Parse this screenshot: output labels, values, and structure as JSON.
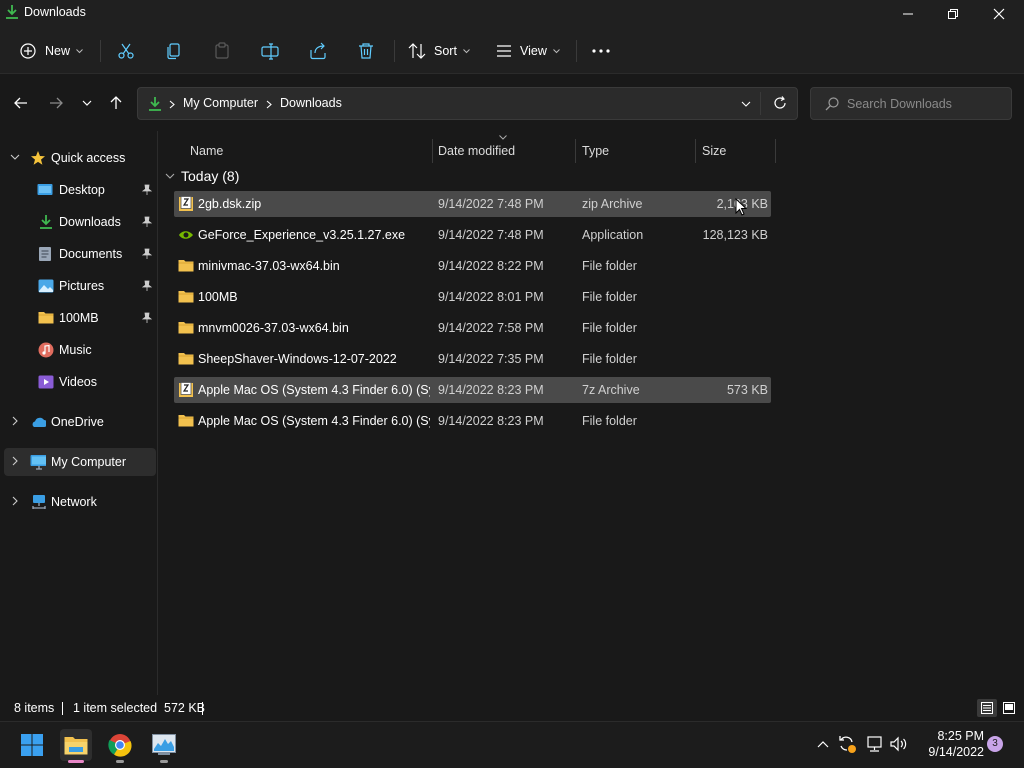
{
  "window": {
    "title": "Downloads"
  },
  "toolbar": {
    "new_label": "New",
    "sort_label": "Sort",
    "view_label": "View"
  },
  "address": {
    "crumbs": [
      "My Computer",
      "Downloads"
    ]
  },
  "search": {
    "placeholder": "Search Downloads"
  },
  "sidebar": {
    "items": [
      {
        "label": "Quick access",
        "icon": "star-icon"
      },
      {
        "label": "Desktop",
        "icon": "desktop-icon",
        "pinned": true
      },
      {
        "label": "Downloads",
        "icon": "download-icon",
        "pinned": true
      },
      {
        "label": "Documents",
        "icon": "documents-icon",
        "pinned": true
      },
      {
        "label": "Pictures",
        "icon": "pictures-icon",
        "pinned": true
      },
      {
        "label": "100MB",
        "icon": "folder-icon",
        "pinned": true
      },
      {
        "label": "Music",
        "icon": "music-icon"
      },
      {
        "label": "Videos",
        "icon": "videos-icon"
      },
      {
        "label": "OneDrive",
        "icon": "cloud-icon"
      },
      {
        "label": "My Computer",
        "icon": "computer-icon",
        "selected": true
      },
      {
        "label": "Network",
        "icon": "network-icon"
      }
    ]
  },
  "columns": {
    "name": "Name",
    "date": "Date modified",
    "type": "Type",
    "size": "Size"
  },
  "group": {
    "label": "Today (8)"
  },
  "files": [
    {
      "name": "2gb.dsk.zip",
      "date": "9/14/2022 7:48 PM",
      "type": "zip Archive",
      "size": "2,103 KB",
      "icon": "archive-icon",
      "selected": true
    },
    {
      "name": "GeForce_Experience_v3.25.1.27.exe",
      "date": "9/14/2022 7:48 PM",
      "type": "Application",
      "size": "128,123 KB",
      "icon": "nvidia-icon"
    },
    {
      "name": "minivmac-37.03-wx64.bin",
      "date": "9/14/2022 8:22 PM",
      "type": "File folder",
      "size": "",
      "icon": "folder-icon"
    },
    {
      "name": "100MB",
      "date": "9/14/2022 8:01 PM",
      "type": "File folder",
      "size": "",
      "icon": "folder-icon"
    },
    {
      "name": "mnvm0026-37.03-wx64.bin",
      "date": "9/14/2022 7:58 PM",
      "type": "File folder",
      "size": "",
      "icon": "folder-icon"
    },
    {
      "name": "SheepShaver-Windows-12-07-2022",
      "date": "9/14/2022 7:35 PM",
      "type": "File folder",
      "size": "",
      "icon": "folder-icon"
    },
    {
      "name": "Apple Mac OS (System 4.3 Finder 6.0) (Sy...",
      "date": "9/14/2022 8:23 PM",
      "type": "7z Archive",
      "size": "573 KB",
      "icon": "archive-icon",
      "selected": true
    },
    {
      "name": "Apple Mac OS (System 4.3 Finder 6.0) (Sy...",
      "date": "9/14/2022 8:23 PM",
      "type": "File folder",
      "size": "",
      "icon": "folder-icon"
    }
  ],
  "status": {
    "items": "8 items",
    "selection": "1 item selected  572 KB"
  },
  "taskbar": {
    "time": "8:25 PM",
    "date": "9/14/2022",
    "notification_count": "3"
  },
  "colors": {
    "accent_green": "#3fb950",
    "folder_yellow": "#f2c14e",
    "selection_bg": "#4a4a4a"
  }
}
